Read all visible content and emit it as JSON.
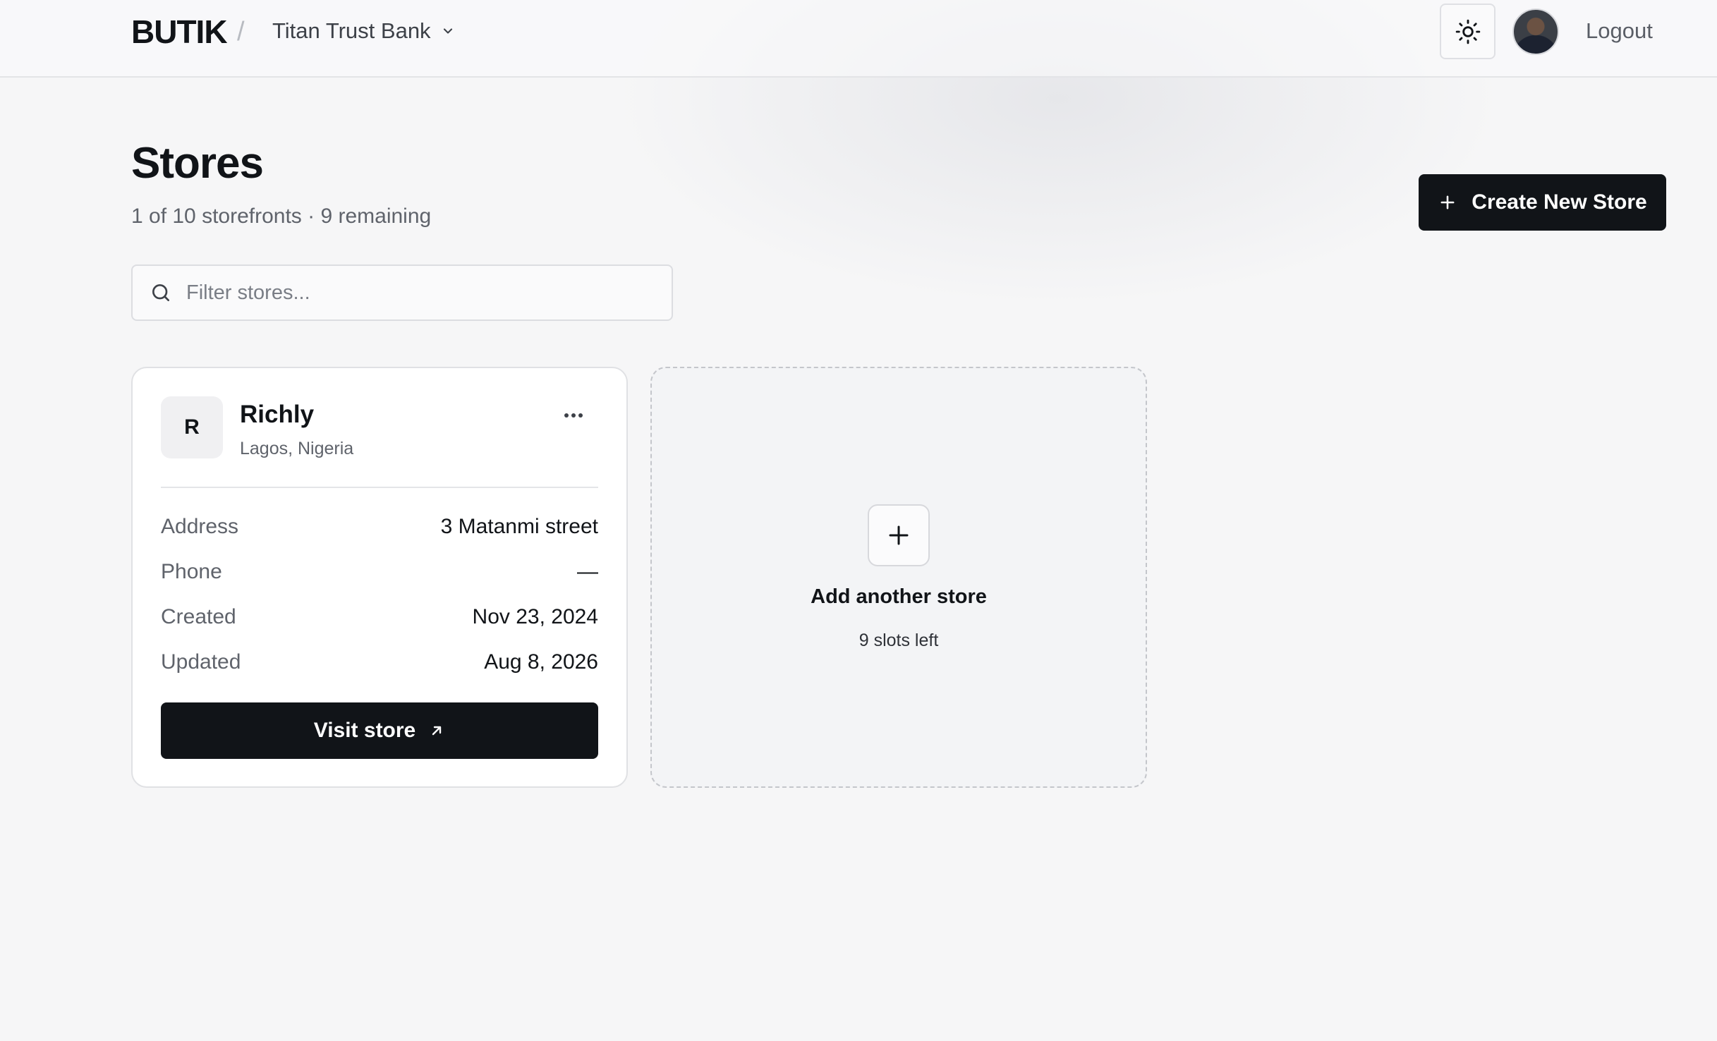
{
  "header": {
    "brand": "BUTIK",
    "separator": "/",
    "org_name": "Titan Trust Bank",
    "logout_label": "Logout"
  },
  "page": {
    "title": "Stores",
    "subtitle": "1 of 10 storefronts · 9 remaining",
    "create_label": "Create New Store",
    "search_placeholder": "Filter stores..."
  },
  "stores": [
    {
      "initial": "R",
      "name": "Richly",
      "location": "Lagos, Nigeria",
      "fields": [
        {
          "label": "Address",
          "value": "3 Matanmi street"
        },
        {
          "label": "Phone",
          "value": "—"
        },
        {
          "label": "Created",
          "value": "Nov 23, 2024"
        },
        {
          "label": "Updated",
          "value": "Aug 8, 2026"
        }
      ],
      "visit_label": "Visit store"
    }
  ],
  "add_card": {
    "title": "Add another store",
    "subtitle": "9 slots left"
  },
  "icons": {
    "theme": "sun-icon",
    "org_dropdown": "chevron-down-icon",
    "search": "search-icon",
    "create": "plus-icon",
    "more": "more-horizontal-icon",
    "visit": "arrow-up-right-icon",
    "add": "plus-icon"
  },
  "colors": {
    "primary": "#111418",
    "background": "#f6f6f7",
    "muted_text": "#5f636b",
    "border": "#e0e1e4"
  }
}
